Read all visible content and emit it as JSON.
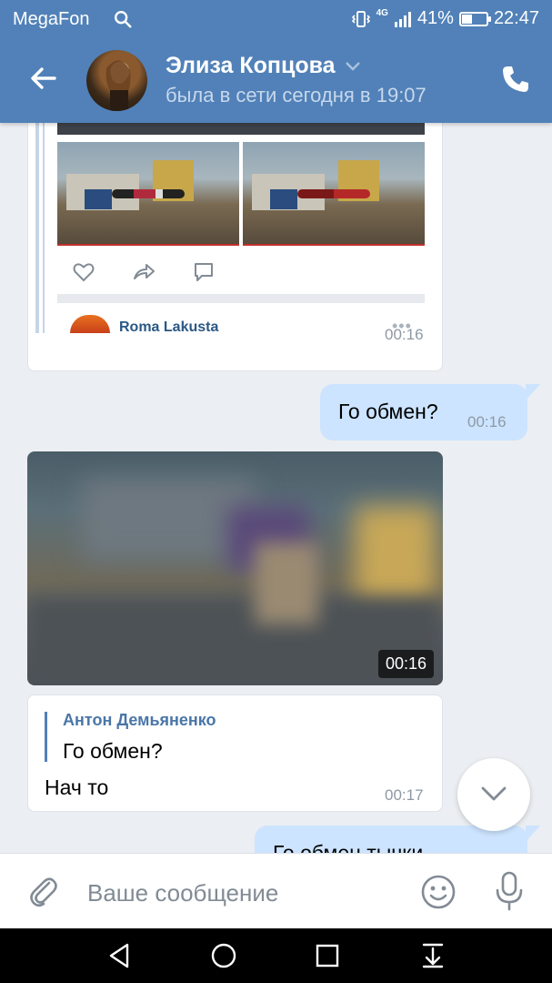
{
  "status_bar": {
    "carrier": "MegaFon",
    "network": "4G",
    "battery": "41%",
    "time": "22:47"
  },
  "header": {
    "contact_name": "Элиза Копцова",
    "last_seen": "была в сети сегодня в 19:07"
  },
  "messages": {
    "shared_post": {
      "author": "Roma Lakusta",
      "time": "00:16"
    },
    "outgoing_1": {
      "text": "Го обмен?",
      "time": "00:16"
    },
    "video": {
      "duration": "00:16"
    },
    "reply": {
      "quoted_author": "Антон Демьяненко",
      "quoted_text": "Го обмен?",
      "text": "Нач то",
      "time": "00:17"
    },
    "outgoing_2": {
      "text": "Го обмен тычки"
    }
  },
  "composer": {
    "placeholder": "Ваше сообщение"
  },
  "colors": {
    "header_bg": "#5181b8",
    "outgoing_bubble": "#cce4ff",
    "chat_bg": "#ebeef2",
    "link": "#4a76a8"
  },
  "icons": [
    "search-icon",
    "vibrate-icon",
    "signal-icon",
    "battery-icon",
    "back-arrow-icon",
    "chevron-down-icon",
    "phone-icon",
    "like-icon",
    "share-icon",
    "comment-icon",
    "more-dots-icon",
    "scroll-down-icon",
    "attach-icon",
    "emoji-icon",
    "mic-icon",
    "nav-back-icon",
    "nav-home-icon",
    "nav-recents-icon",
    "nav-notifications-icon"
  ]
}
